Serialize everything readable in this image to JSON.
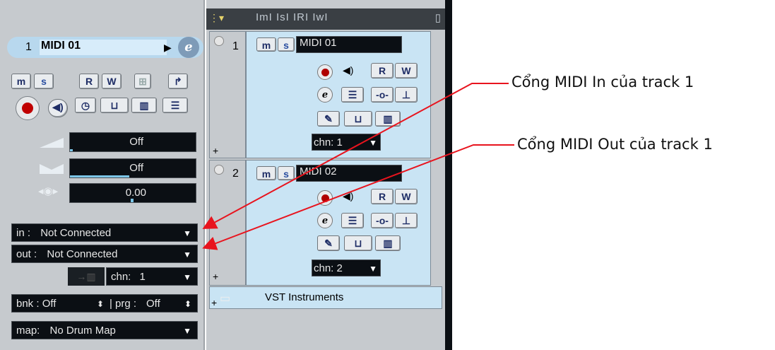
{
  "inspector": {
    "track_number": "1",
    "track_name": "MIDI 01",
    "e_label": "e",
    "buttons": {
      "mute": "m",
      "solo": "s",
      "read": "R",
      "write": "W"
    },
    "volume": "Off",
    "pan": "Off",
    "delay": "0.00",
    "in_label": "in :",
    "in_value": "Not Connected",
    "out_label": "out :",
    "out_value": "Not Connected",
    "chn_label": "chn:",
    "chn_value": "1",
    "bnk_label": "bnk :",
    "bnk_value": "Off",
    "prg_label": "prg :",
    "prg_value": "Off",
    "map_label": "map:",
    "map_value": "No Drum Map"
  },
  "tracklist": {
    "header": "ImI IsI IRI IwI",
    "tracks": [
      {
        "number": "1",
        "name": "MIDI 01",
        "chn_label": "chn:",
        "chn_value": "1"
      },
      {
        "number": "2",
        "name": "MIDI 02",
        "chn_label": "chn:",
        "chn_value": "2"
      }
    ],
    "vst_label": "VST Instruments",
    "plus": "+"
  },
  "annotations": {
    "midi_in": "Cổng MIDI In của track 1",
    "midi_out": "Cổng MIDI Out của track 1"
  },
  "colors": {
    "arrow": "#e8141e",
    "track_bg": "#c9e4f4",
    "panel_bg": "#c6cace"
  }
}
